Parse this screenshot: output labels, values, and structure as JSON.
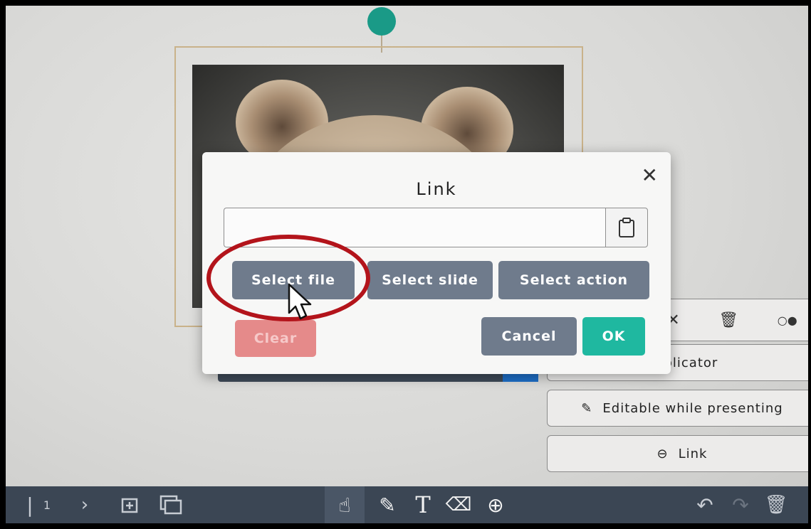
{
  "dialog": {
    "title": "Link",
    "close_icon": "close-icon",
    "url_value": "",
    "url_placeholder": "",
    "paste_icon": "clipboard-icon",
    "buttons": {
      "select_file": "Select file",
      "select_slide": "Select slide",
      "select_action": "Select action",
      "clear": "Clear",
      "cancel": "Cancel",
      "ok": "OK"
    }
  },
  "side_panel": {
    "replicator_label": "Replicator",
    "editable_label": "Editable while presenting",
    "link_label": "Link",
    "icons": [
      "close-icon",
      "trash-icon",
      "more-icon"
    ]
  },
  "bottom_toolbar": {
    "page_number": "1",
    "tools": [
      "next-icon",
      "add-page-icon",
      "duplicate-page-icon",
      "hand-tool-icon",
      "pen-tool-icon",
      "text-tool-icon",
      "eraser-tool-icon",
      "add-tool-icon",
      "undo-icon",
      "redo-icon",
      "trash-icon"
    ]
  },
  "colors": {
    "accent_teal": "#1fb8a0",
    "button_gray": "#6f7b8c",
    "clear_red": "#e58a8a",
    "highlight_red": "#b3141b",
    "toolbar_dark": "#3b4654"
  }
}
